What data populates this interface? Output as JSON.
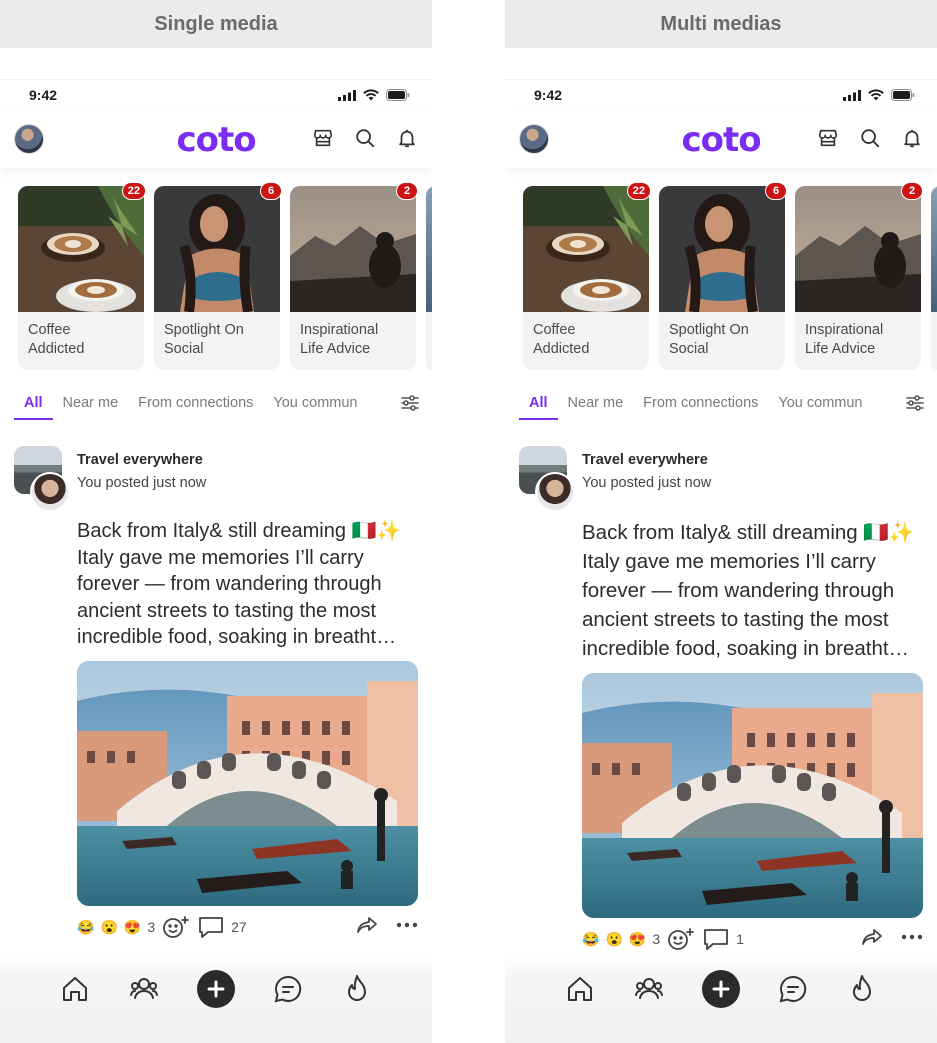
{
  "colors": {
    "brand": "#7a2cf0",
    "badge": "#cc1414",
    "header_bg": "#ebebeb"
  },
  "panels": [
    {
      "title": "Single media",
      "status": {
        "time": "9:42"
      },
      "logo": "coto",
      "stories": [
        {
          "label_1": "Coffee",
          "label_2": "Addicted",
          "badge": "22"
        },
        {
          "label_1": "Spotlight On",
          "label_2": "Social",
          "badge": "6"
        },
        {
          "label_1": "Inspirational",
          "label_2": "Life Advice",
          "badge": "2"
        }
      ],
      "tabs": [
        "All",
        "Near me",
        "From connections",
        "You commun"
      ],
      "post": {
        "group": "Travel everywhere",
        "meta": "You posted just now",
        "lines": [
          "Back from Italy& still dreaming 🇮🇹✨",
          "Italy gave me memories I’ll carry",
          "forever — from wandering through",
          "ancient streets to tasting the most",
          "incredible food, soaking in breatht…"
        ],
        "reactions_count": "3",
        "comments_count": "27"
      }
    },
    {
      "title": "Multi medias",
      "status": {
        "time": "9:42"
      },
      "logo": "coto",
      "stories": [
        {
          "label_1": "Coffee",
          "label_2": "Addicted",
          "badge": "22"
        },
        {
          "label_1": "Spotlight On",
          "label_2": "Social",
          "badge": "6"
        },
        {
          "label_1": "Inspirational",
          "label_2": "Life Advice",
          "badge": "2"
        }
      ],
      "tabs": [
        "All",
        "Near me",
        "From connections",
        "You commun"
      ],
      "post": {
        "group": "Travel everywhere",
        "meta": "You posted just now",
        "lines": [
          "Back from Italy& still dreaming 🇮🇹✨",
          "Italy gave me memories I’ll carry",
          "forever — from wandering through",
          "ancient streets to tasting the most",
          "incredible food, soaking in breatht…"
        ],
        "reactions_count": "3",
        "comments_count": "1"
      }
    }
  ],
  "reaction_emojis": [
    "😂",
    "😮",
    "😍"
  ]
}
